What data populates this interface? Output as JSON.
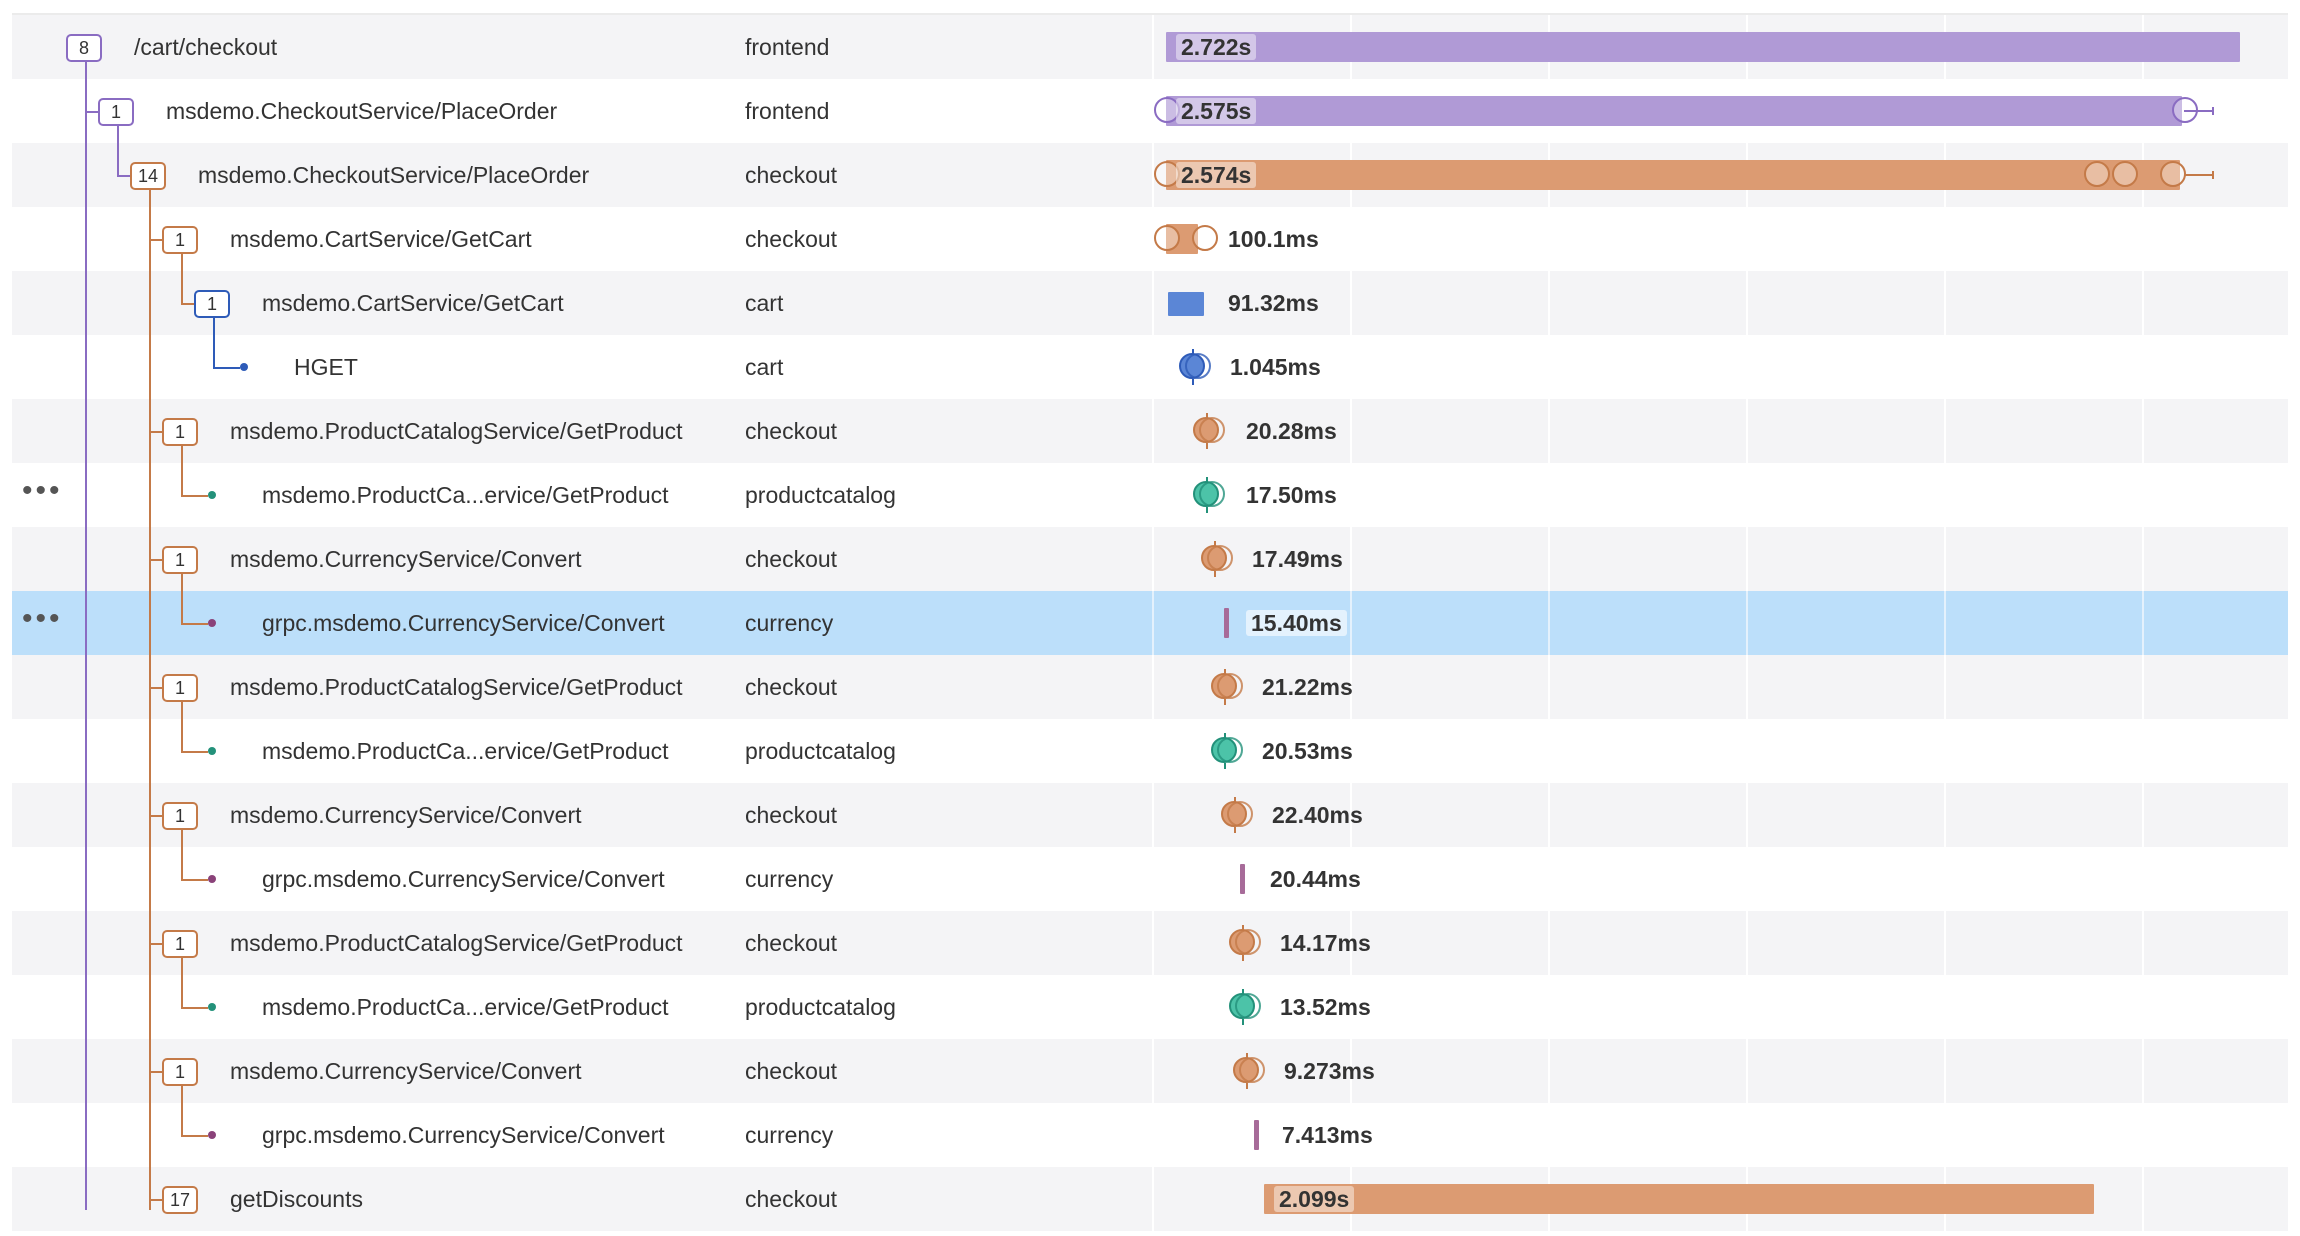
{
  "colors": {
    "frontend": "#b09ad6",
    "frontend_dark": "#8a6cc2",
    "checkout": "#dc9b72",
    "checkout_dark": "#c47a48",
    "cart": "#5b86d6",
    "cart_dark": "#2e5bb8",
    "productcatalog": "#4cc3a8",
    "productcatalog_dark": "#23917a",
    "currency": "#a76b99",
    "currency_dark": "#8a4279",
    "selected_row": "#bcdffa"
  },
  "icons": {
    "more": "more-horizontal-icon",
    "collapse_badge": "child-count-badge",
    "event_marker": "span-event-circle"
  },
  "rows": [
    {
      "name": "/cart/checkout",
      "service": "frontend",
      "duration": "2.722s",
      "children": "8"
    },
    {
      "name": "msdemo.CheckoutService/PlaceOrder",
      "service": "frontend",
      "duration": "2.575s",
      "children": "1"
    },
    {
      "name": "msdemo.CheckoutService/PlaceOrder",
      "service": "checkout",
      "duration": "2.574s",
      "children": "14"
    },
    {
      "name": "msdemo.CartService/GetCart",
      "service": "checkout",
      "duration": "100.1ms",
      "children": "1"
    },
    {
      "name": "msdemo.CartService/GetCart",
      "service": "cart",
      "duration": "91.32ms",
      "children": "1"
    },
    {
      "name": "HGET",
      "service": "cart",
      "duration": "1.045ms",
      "children": ""
    },
    {
      "name": "msdemo.ProductCatalogService/GetProduct",
      "service": "checkout",
      "duration": "20.28ms",
      "children": "1"
    },
    {
      "name": "msdemo.ProductCa...ervice/GetProduct",
      "service": "productcatalog",
      "duration": "17.50ms",
      "children": ""
    },
    {
      "name": "msdemo.CurrencyService/Convert",
      "service": "checkout",
      "duration": "17.49ms",
      "children": "1"
    },
    {
      "name": "grpc.msdemo.CurrencyService/Convert",
      "service": "currency",
      "duration": "15.40ms",
      "children": ""
    },
    {
      "name": "msdemo.ProductCatalogService/GetProduct",
      "service": "checkout",
      "duration": "21.22ms",
      "children": "1"
    },
    {
      "name": "msdemo.ProductCa...ervice/GetProduct",
      "service": "productcatalog",
      "duration": "20.53ms",
      "children": ""
    },
    {
      "name": "msdemo.CurrencyService/Convert",
      "service": "checkout",
      "duration": "22.40ms",
      "children": "1"
    },
    {
      "name": "grpc.msdemo.CurrencyService/Convert",
      "service": "currency",
      "duration": "20.44ms",
      "children": ""
    },
    {
      "name": "msdemo.ProductCatalogService/GetProduct",
      "service": "checkout",
      "duration": "14.17ms",
      "children": "1"
    },
    {
      "name": "msdemo.ProductCa...ervice/GetProduct",
      "service": "productcatalog",
      "duration": "13.52ms",
      "children": ""
    },
    {
      "name": "msdemo.CurrencyService/Convert",
      "service": "checkout",
      "duration": "9.273ms",
      "children": "1"
    },
    {
      "name": "grpc.msdemo.CurrencyService/Convert",
      "service": "currency",
      "duration": "7.413ms",
      "children": ""
    },
    {
      "name": "getDiscounts",
      "service": "checkout",
      "duration": "2.099s",
      "children": "17"
    }
  ]
}
